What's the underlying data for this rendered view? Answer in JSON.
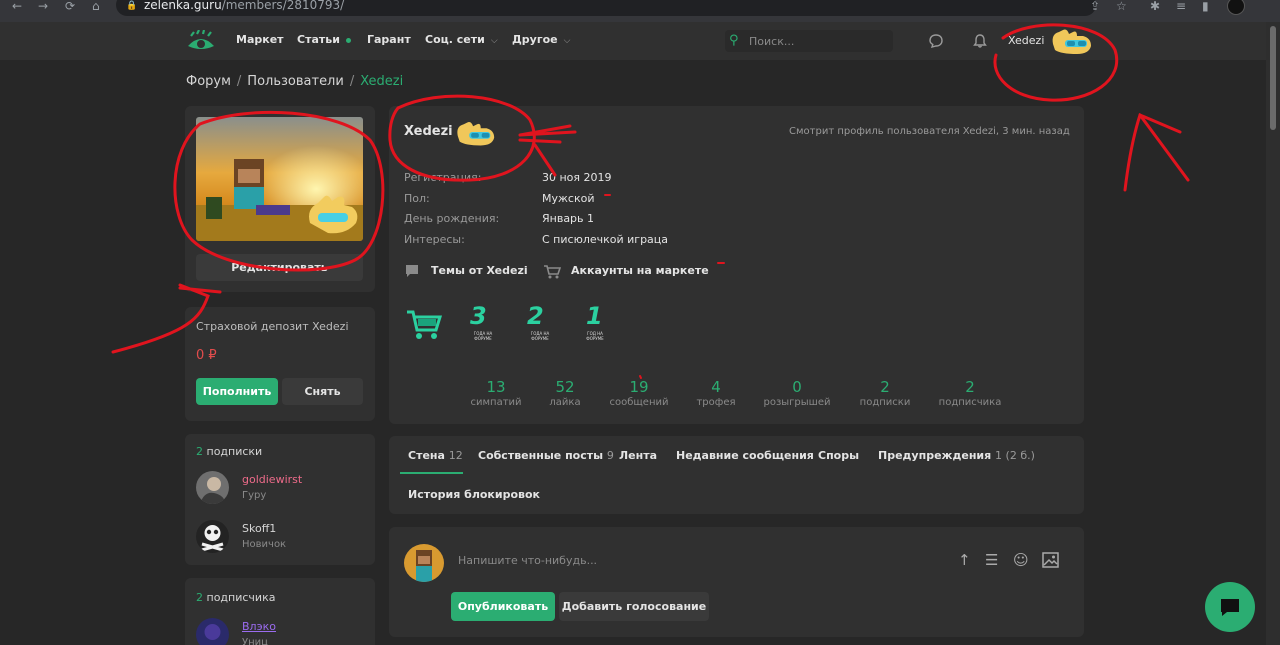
{
  "browser": {
    "url_host": "zelenka.guru",
    "url_path": "/members/2810793/"
  },
  "header": {
    "nav": [
      {
        "label": "Маркет"
      },
      {
        "label": "Статьи"
      },
      {
        "label": "Гарант"
      },
      {
        "label": "Соц. сети"
      },
      {
        "label": "Другое"
      }
    ],
    "search_placeholder": "Поиск...",
    "username": "Xedezi"
  },
  "breadcrumb": [
    "Форум",
    "Пользователи",
    "Xedezi"
  ],
  "sidebar": {
    "edit_label": "Редактировать",
    "deposit_title": "Страховой депозит Xedezi",
    "deposit_value": "0 ₽",
    "topup_label": "Пополнить",
    "withdraw_label": "Снять",
    "following": {
      "count": "2",
      "label": "подписки",
      "users": [
        {
          "name": "goldiewirst",
          "rank": "Гуру",
          "color": "#ee6b8a"
        },
        {
          "name": "Skoff1",
          "rank": "Новичок",
          "color": "#d6d6d6"
        }
      ]
    },
    "followers": {
      "count": "2",
      "label": "подписчика",
      "users": [
        {
          "name": "Влэко",
          "rank": "Униц",
          "color": "#9b6cf0"
        }
      ]
    }
  },
  "profile": {
    "name": "Xedezi",
    "status": "Смотрит профиль пользователя Xedezi, 3 мин. назад",
    "info": [
      {
        "label": "Регистрация:",
        "value": "30 ноя 2019"
      },
      {
        "label": "Пол:",
        "value": "Мужской"
      },
      {
        "label": "День рождения:",
        "value": "Январь 1"
      },
      {
        "label": "Интересы:",
        "value": "С писюлечкой играца"
      }
    ],
    "links": {
      "threads": "Темы от Xedezi",
      "market": "Аккаунты на маркете"
    },
    "badges": [
      {
        "icon": "market-cart-badge-icon"
      },
      {
        "icon": "three-years-badge-icon",
        "num": "3",
        "caption": "ГОДА НА ФОРУМЕ"
      },
      {
        "icon": "two-years-badge-icon",
        "num": "2",
        "caption": "ГОДА НА ФОРУМЕ"
      },
      {
        "icon": "one-year-badge-icon",
        "num": "1",
        "caption": "ГОД НА ФОРУМЕ"
      }
    ],
    "stats": [
      {
        "value": "13",
        "label": "симпатий"
      },
      {
        "value": "52",
        "label": "лайка"
      },
      {
        "value": "19",
        "label": "сообщений"
      },
      {
        "value": "4",
        "label": "трофея"
      },
      {
        "value": "0",
        "label": "розыгрышей"
      },
      {
        "value": "2",
        "label": "подписки"
      },
      {
        "value": "2",
        "label": "подписчика"
      }
    ]
  },
  "tabs": [
    {
      "label": "Стена",
      "count": "12"
    },
    {
      "label": "Собственные посты",
      "count": "9"
    },
    {
      "label": "Лента",
      "count": ""
    },
    {
      "label": "Недавние сообщения",
      "count": ""
    },
    {
      "label": "Споры",
      "count": ""
    },
    {
      "label": "Предупреждения",
      "count": "1 (2 б.)"
    },
    {
      "label": "История блокировок",
      "count": ""
    }
  ],
  "composer": {
    "placeholder": "Напишите что-нибудь...",
    "publish_label": "Опубликовать",
    "poll_label": "Добавить голосование"
  },
  "colors": {
    "accent": "#2bad72",
    "background": "#272727",
    "panel": "#303030",
    "danger": "#e24c4c",
    "annotation": "#e0141e"
  }
}
